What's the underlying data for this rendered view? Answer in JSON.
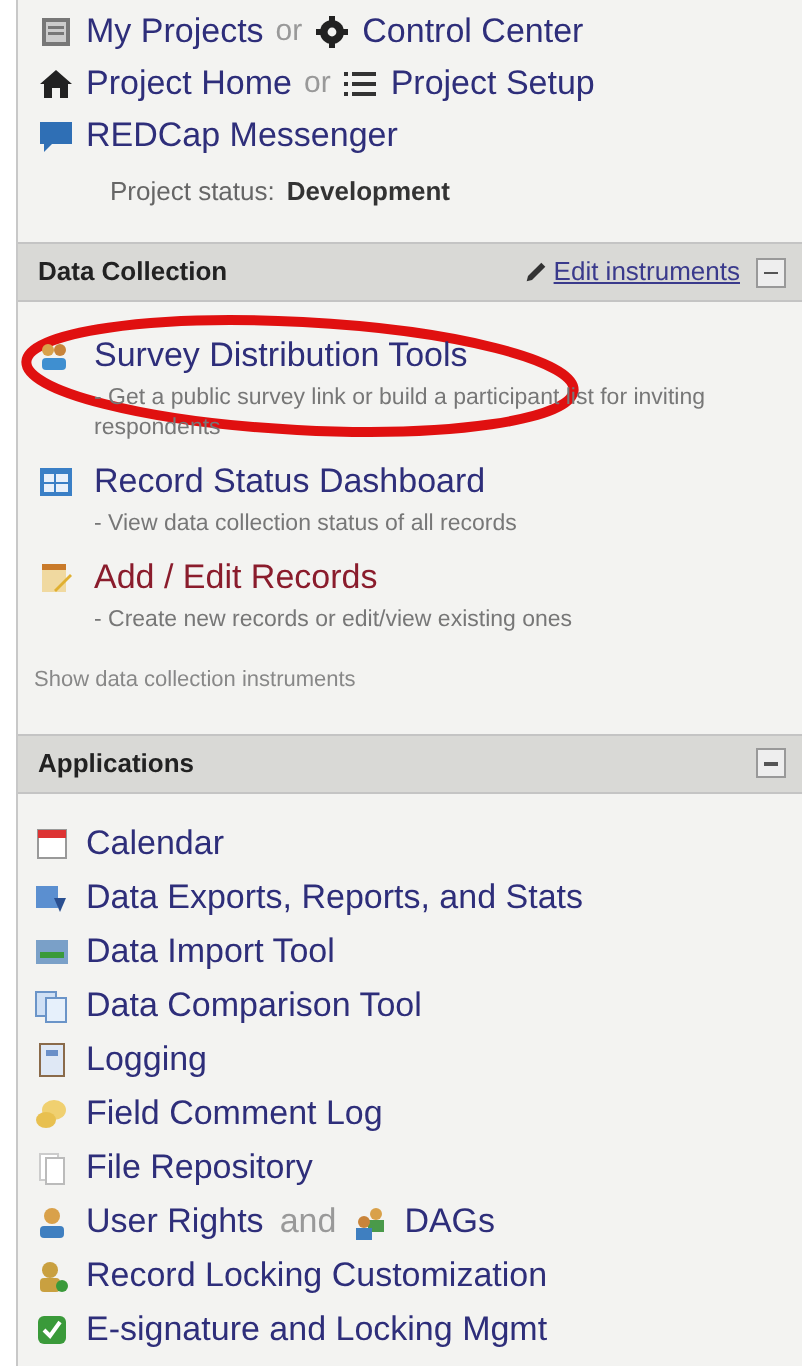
{
  "top_rows": [
    {
      "items": [
        "My Projects",
        "Control Center"
      ],
      "joiner": "or"
    },
    {
      "items": [
        "Project Home",
        "Project Setup"
      ],
      "joiner": "or"
    },
    {
      "items": [
        "REDCap Messenger"
      ]
    }
  ],
  "project_status": {
    "label": "Project status:",
    "value": "Development"
  },
  "sections": [
    {
      "title": "Data Collection",
      "action": "Edit instruments",
      "expanded": true,
      "items": [
        {
          "label": "Survey Distribution Tools",
          "description": "- Get a public survey link or build a participant list for inviting respondents",
          "color": "#2e2e7a"
        },
        {
          "label": "Record Status Dashboard",
          "description": "- View data collection status of all records",
          "color": "#2e2e7a"
        },
        {
          "label": "Add / Edit Records",
          "description": "- Create new records or edit/view existing ones",
          "color": "#8a1c2c"
        }
      ],
      "footer": "Show data collection instruments"
    },
    {
      "title": "Applications",
      "expanded": true,
      "items": [
        {
          "label": "Calendar"
        },
        {
          "label": "Data Exports, Reports, and Stats"
        },
        {
          "label": "Data Import Tool"
        },
        {
          "label": "Data Comparison Tool"
        },
        {
          "label": "Logging"
        },
        {
          "label": "Field Comment Log"
        },
        {
          "label": "File Repository"
        },
        {
          "label": "User Rights",
          "joiner": "and",
          "second": "DAGs"
        },
        {
          "label": "Record Locking Customization"
        },
        {
          "label": "E-signature and Locking Mgmt"
        }
      ]
    }
  ],
  "annotation": {
    "kind": "ellipse",
    "color": "#e01010"
  }
}
